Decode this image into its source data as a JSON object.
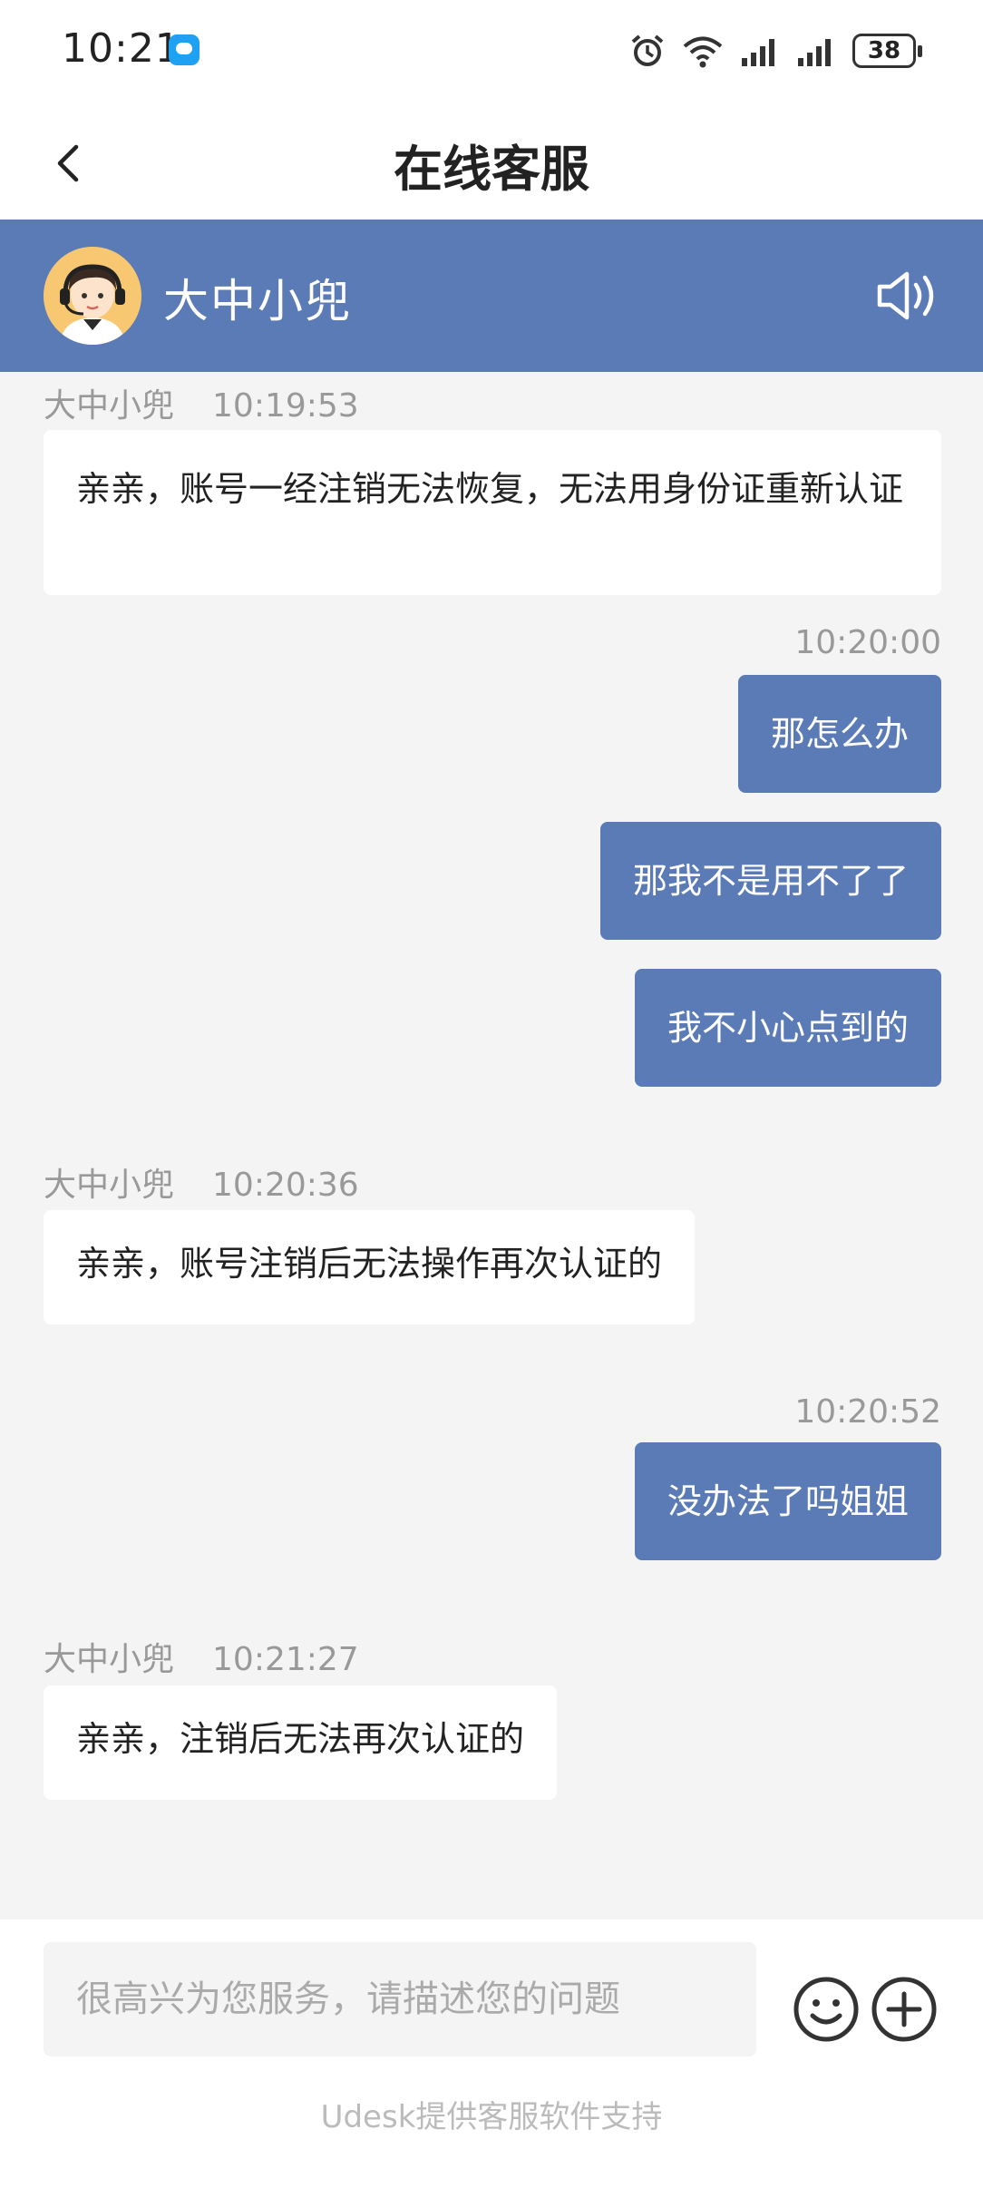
{
  "status_bar": {
    "time": "10:21",
    "battery": "38",
    "icons": [
      "message-app-icon",
      "alarm-icon",
      "wifi-icon",
      "signal-icon",
      "signal-icon",
      "battery-icon"
    ]
  },
  "header": {
    "title": "在线客服",
    "back_icon": "chevron-left-icon"
  },
  "agent": {
    "name": "大中小兜",
    "speaker_icon": "speaker-icon"
  },
  "messages": [
    {
      "direction": "in",
      "sender": "大中小兜",
      "time": "10:19:53",
      "text": "亲亲，账号一经注销无法恢复，无法用身份证重新认证"
    },
    {
      "direction": "out",
      "time": "10:20:00",
      "text": "那怎么办"
    },
    {
      "direction": "out",
      "text": "那我不是用不了了"
    },
    {
      "direction": "out",
      "text": "我不小心点到的"
    },
    {
      "direction": "in",
      "sender": "大中小兜",
      "time": "10:20:36",
      "text": "亲亲，账号注销后无法操作再次认证的"
    },
    {
      "direction": "out",
      "time": "10:20:52",
      "text": "没办法了吗姐姐"
    },
    {
      "direction": "in",
      "sender": "大中小兜",
      "time": "10:21:27",
      "text": "亲亲，注销后无法再次认证的"
    }
  ],
  "input": {
    "placeholder": "很高兴为您服务，请描述您的问题",
    "value": ""
  },
  "footer": {
    "powered_by": "Udesk提供客服软件支持"
  },
  "colors": {
    "accent": "#5b7bb7",
    "background": "#f4f4f4",
    "incoming_bubble": "#ffffff"
  }
}
